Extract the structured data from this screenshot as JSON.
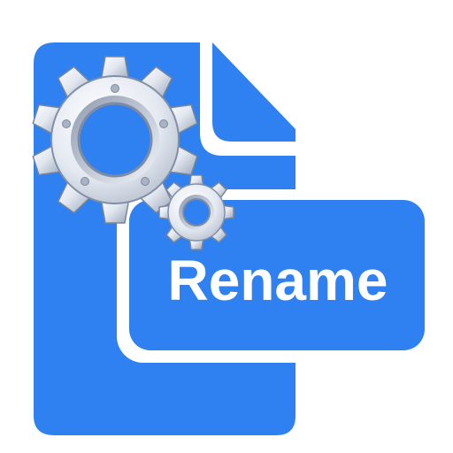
{
  "icon": {
    "label": "Rename",
    "semantic": "rename-file-app-icon",
    "glyphs": [
      "document-icon",
      "large-gear-icon",
      "small-gear-icon"
    ]
  },
  "colors": {
    "background": "#ffffff",
    "document_blue": "#2f80f0",
    "label_text": "#ffffff",
    "gear_light": "#f1f4f9",
    "gear_mid": "#c7cfdb",
    "gear_dark": "#8e9aad",
    "gear_outline": "#7a869a"
  }
}
